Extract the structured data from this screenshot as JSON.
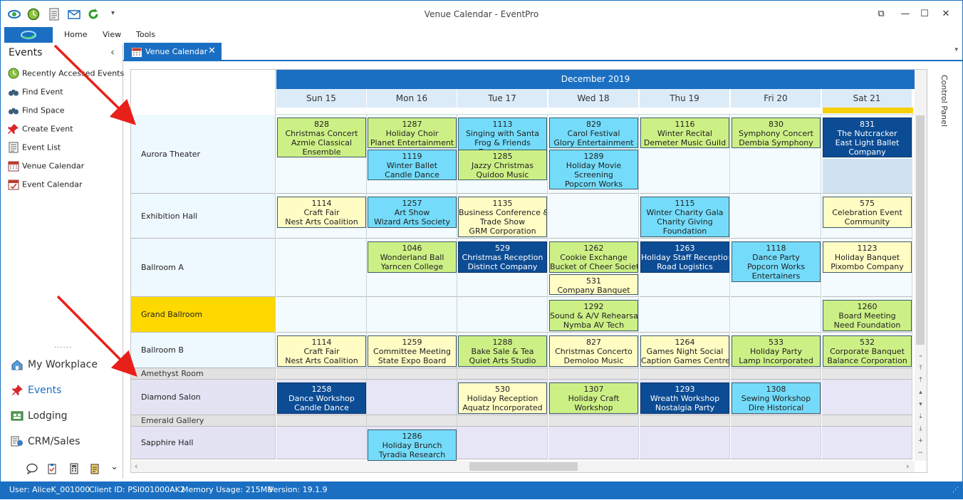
{
  "window": {
    "title": "Venue Calendar - EventPro",
    "restore_label": "⧉",
    "maximize_label": "☐",
    "close_label": "✕"
  },
  "quick_access": {
    "icons": [
      "refresh-view-icon",
      "clock-icon",
      "document-icon",
      "mail-icon",
      "green-refresh-icon"
    ],
    "dropdown": "▾"
  },
  "ribbon": {
    "tabs": [
      "Home",
      "View",
      "Tools"
    ]
  },
  "nav": {
    "title": "Events",
    "collapse_glyph": "‹",
    "items": [
      {
        "label": "Recently Accessed Events",
        "icon": "clock-icon"
      },
      {
        "label": "Find Event",
        "icon": "binoculars-icon"
      },
      {
        "label": "Find Space",
        "icon": "binoculars-icon"
      },
      {
        "label": "Create Event",
        "icon": "pushpin-icon"
      },
      {
        "label": "Event List",
        "icon": "list-icon"
      },
      {
        "label": "Venue Calendar",
        "icon": "calendar-icon"
      },
      {
        "label": "Event Calendar",
        "icon": "calendar-icon"
      }
    ],
    "splitter": "......",
    "modules": [
      {
        "label": "My Workplace",
        "icon": "home-icon"
      },
      {
        "label": "Events",
        "icon": "pushpin-icon"
      },
      {
        "label": "Lodging",
        "icon": "lodging-icon"
      },
      {
        "label": "CRM/Sales",
        "icon": "crm-icon"
      }
    ],
    "module_dropdown": "⌄"
  },
  "doc_tab": {
    "label": "Venue Calendar",
    "close": "✕",
    "dropdown": "▾"
  },
  "calendar": {
    "month": "December 2019",
    "days": [
      "Sun 15",
      "Mon 16",
      "Tue 17",
      "Wed 18",
      "Thu 19",
      "Fri 20",
      "Sat 21"
    ],
    "venues": [
      {
        "name": "Aurora Theater",
        "type": "venue"
      },
      {
        "name": "Exhibition Hall",
        "type": "venue"
      },
      {
        "name": "Ballroom A",
        "type": "venue"
      },
      {
        "name": "Grand Ballroom",
        "type": "venue-selected"
      },
      {
        "name": "Ballroom B",
        "type": "venue"
      },
      {
        "name": "Amethyst Room",
        "type": "group"
      },
      {
        "name": "Diamond Salon",
        "type": "venue-lav"
      },
      {
        "name": "Emerald Gallery",
        "type": "group"
      },
      {
        "name": "Sapphire Hall",
        "type": "venue-lav"
      }
    ],
    "events": [
      {
        "row": 0,
        "day": 0,
        "slot": 0,
        "color": "green",
        "lines": [
          "828",
          "Christmas Concert",
          "Azmie Classical",
          "Ensemble"
        ]
      },
      {
        "row": 0,
        "day": 1,
        "slot": 0,
        "color": "green",
        "lines": [
          "1287",
          "Holiday Choir",
          "Planet Entertainment"
        ]
      },
      {
        "row": 0,
        "day": 1,
        "slot": 1,
        "color": "cyan",
        "lines": [
          "1119",
          "Winter Ballet",
          "Candle Dance"
        ]
      },
      {
        "row": 0,
        "day": 2,
        "slot": 0,
        "color": "cyan",
        "lines": [
          "1113",
          "Singing with Santa",
          "Frog & Friends",
          "Entertainers"
        ]
      },
      {
        "row": 0,
        "day": 2,
        "slot": 1,
        "color": "green",
        "lines": [
          "1285",
          "Jazzy Christmas",
          "Quidoo Music"
        ]
      },
      {
        "row": 0,
        "day": 3,
        "slot": 0,
        "color": "cyan",
        "lines": [
          "829",
          "Carol Festival",
          "Glory Entertainment"
        ]
      },
      {
        "row": 0,
        "day": 3,
        "slot": 1,
        "color": "cyan",
        "lines": [
          "1289",
          "Holiday Movie",
          "Screening",
          "Popcorn Works"
        ]
      },
      {
        "row": 0,
        "day": 4,
        "slot": 0,
        "color": "green",
        "lines": [
          "1116",
          "Winter Recital",
          "Demeter Music Guild"
        ]
      },
      {
        "row": 0,
        "day": 5,
        "slot": 0,
        "color": "green",
        "lines": [
          "830",
          "Symphony Concert",
          "Dembia Symphony"
        ]
      },
      {
        "row": 0,
        "day": 6,
        "slot": 0,
        "color": "navy",
        "lines": [
          "831",
          "The Nutcracker",
          "East Light Ballet",
          "Company"
        ]
      },
      {
        "row": 1,
        "day": 0,
        "slot": 0,
        "color": "yellow",
        "lines": [
          "1114",
          "Craft Fair",
          "Nest Arts Coalition"
        ]
      },
      {
        "row": 1,
        "day": 1,
        "slot": 0,
        "color": "cyan",
        "lines": [
          "1257",
          "Art Show",
          "Wizard Arts Society"
        ]
      },
      {
        "row": 1,
        "day": 2,
        "slot": 0,
        "color": "yellow",
        "lines": [
          "1135",
          "Business Conference &",
          "Trade Show",
          "GRM Corporation"
        ]
      },
      {
        "row": 1,
        "day": 4,
        "slot": 0,
        "color": "cyan",
        "lines": [
          "1115",
          "Winter Charity Gala",
          "Charity Giving",
          "Foundation"
        ]
      },
      {
        "row": 1,
        "day": 6,
        "slot": 0,
        "color": "yellow",
        "lines": [
          "575",
          "Celebration Event",
          "Community"
        ]
      },
      {
        "row": 2,
        "day": 1,
        "slot": 0,
        "color": "green",
        "lines": [
          "1046",
          "Wonderland Ball",
          "Yarncen College"
        ]
      },
      {
        "row": 2,
        "day": 2,
        "slot": 0,
        "color": "navy",
        "lines": [
          "529",
          "Christmas Reception",
          "Distinct Company"
        ]
      },
      {
        "row": 2,
        "day": 3,
        "slot": 0,
        "color": "green",
        "lines": [
          "1262",
          "Cookie Exchange",
          "Bucket of Cheer Society"
        ]
      },
      {
        "row": 2,
        "day": 3,
        "slot": 1,
        "color": "yellow",
        "lines": [
          "531",
          "Company Banquet"
        ]
      },
      {
        "row": 2,
        "day": 4,
        "slot": 0,
        "color": "navy",
        "lines": [
          "1263",
          "Holiday Staff Reception",
          "Road Logistics"
        ]
      },
      {
        "row": 2,
        "day": 5,
        "slot": 0,
        "color": "cyan",
        "lines": [
          "1118",
          "Dance Party",
          "Popcorn Works",
          "Entertainers"
        ]
      },
      {
        "row": 2,
        "day": 6,
        "slot": 0,
        "color": "yellow",
        "lines": [
          "1123",
          "Holiday Banquet",
          "Pixombo Company"
        ]
      },
      {
        "row": 3,
        "day": 3,
        "slot": 0,
        "color": "green",
        "lines": [
          "1292",
          "Sound & A/V Rehearsal",
          "Nymba AV Tech"
        ]
      },
      {
        "row": 3,
        "day": 6,
        "slot": 0,
        "color": "green",
        "lines": [
          "1260",
          "Board Meeting",
          "Need Foundation"
        ]
      },
      {
        "row": 4,
        "day": 0,
        "slot": 0,
        "color": "yellow",
        "lines": [
          "1114",
          "Craft Fair",
          "Nest Arts Coalition"
        ]
      },
      {
        "row": 4,
        "day": 1,
        "slot": 0,
        "color": "yellow",
        "lines": [
          "1259",
          "Committee Meeting",
          "State Expo Board"
        ]
      },
      {
        "row": 4,
        "day": 2,
        "slot": 0,
        "color": "green",
        "lines": [
          "1288",
          "Bake Sale & Tea",
          "Quiet Arts Studio"
        ]
      },
      {
        "row": 4,
        "day": 3,
        "slot": 0,
        "color": "yellow",
        "lines": [
          "827",
          "Christmas Concerto",
          "Demoloo Music"
        ]
      },
      {
        "row": 4,
        "day": 4,
        "slot": 0,
        "color": "yellow",
        "lines": [
          "1264",
          "Games Night Social",
          "Caption Games Centre"
        ]
      },
      {
        "row": 4,
        "day": 5,
        "slot": 0,
        "color": "green",
        "lines": [
          "533",
          "Holiday Party",
          "Lamp Incorporated"
        ]
      },
      {
        "row": 4,
        "day": 6,
        "slot": 0,
        "color": "green",
        "lines": [
          "532",
          "Corporate Banquet",
          "Balance Corporation"
        ]
      },
      {
        "row": 6,
        "day": 0,
        "slot": 0,
        "color": "navy",
        "lines": [
          "1258",
          "Dance Workshop",
          "Candle Dance"
        ]
      },
      {
        "row": 6,
        "day": 2,
        "slot": 0,
        "color": "yellow",
        "lines": [
          "530",
          "Holiday Reception",
          "Aquatz Incorporated"
        ]
      },
      {
        "row": 6,
        "day": 3,
        "slot": 0,
        "color": "green",
        "lines": [
          "1307",
          "Holiday Craft",
          "Workshop"
        ]
      },
      {
        "row": 6,
        "day": 4,
        "slot": 0,
        "color": "navy",
        "lines": [
          "1293",
          "Wreath Workshop",
          "Nostalgia Party"
        ]
      },
      {
        "row": 6,
        "day": 5,
        "slot": 0,
        "color": "cyan",
        "lines": [
          "1308",
          "Sewing Workshop",
          "Dire Historical"
        ]
      },
      {
        "row": 8,
        "day": 1,
        "slot": 0,
        "color": "cyan",
        "lines": [
          "1286",
          "Holiday Brunch",
          "Tyradia Research"
        ]
      }
    ]
  },
  "control_panel": {
    "label": "Control Panel"
  },
  "status": {
    "user": "User: AliceK_001000",
    "client": "Client ID: PSI001000AK2",
    "memory": "Memory Usage: 215MB",
    "version": "Version: 19.1.9"
  },
  "colors": {
    "accent": "#1b6fc2",
    "arrow": "#e8201a",
    "green_event": "#cdf086",
    "yellow_event": "#fffcc4",
    "cyan_event": "#74dcfa",
    "navy_event": "#0c4c94",
    "selected_venue": "#ffd800"
  }
}
